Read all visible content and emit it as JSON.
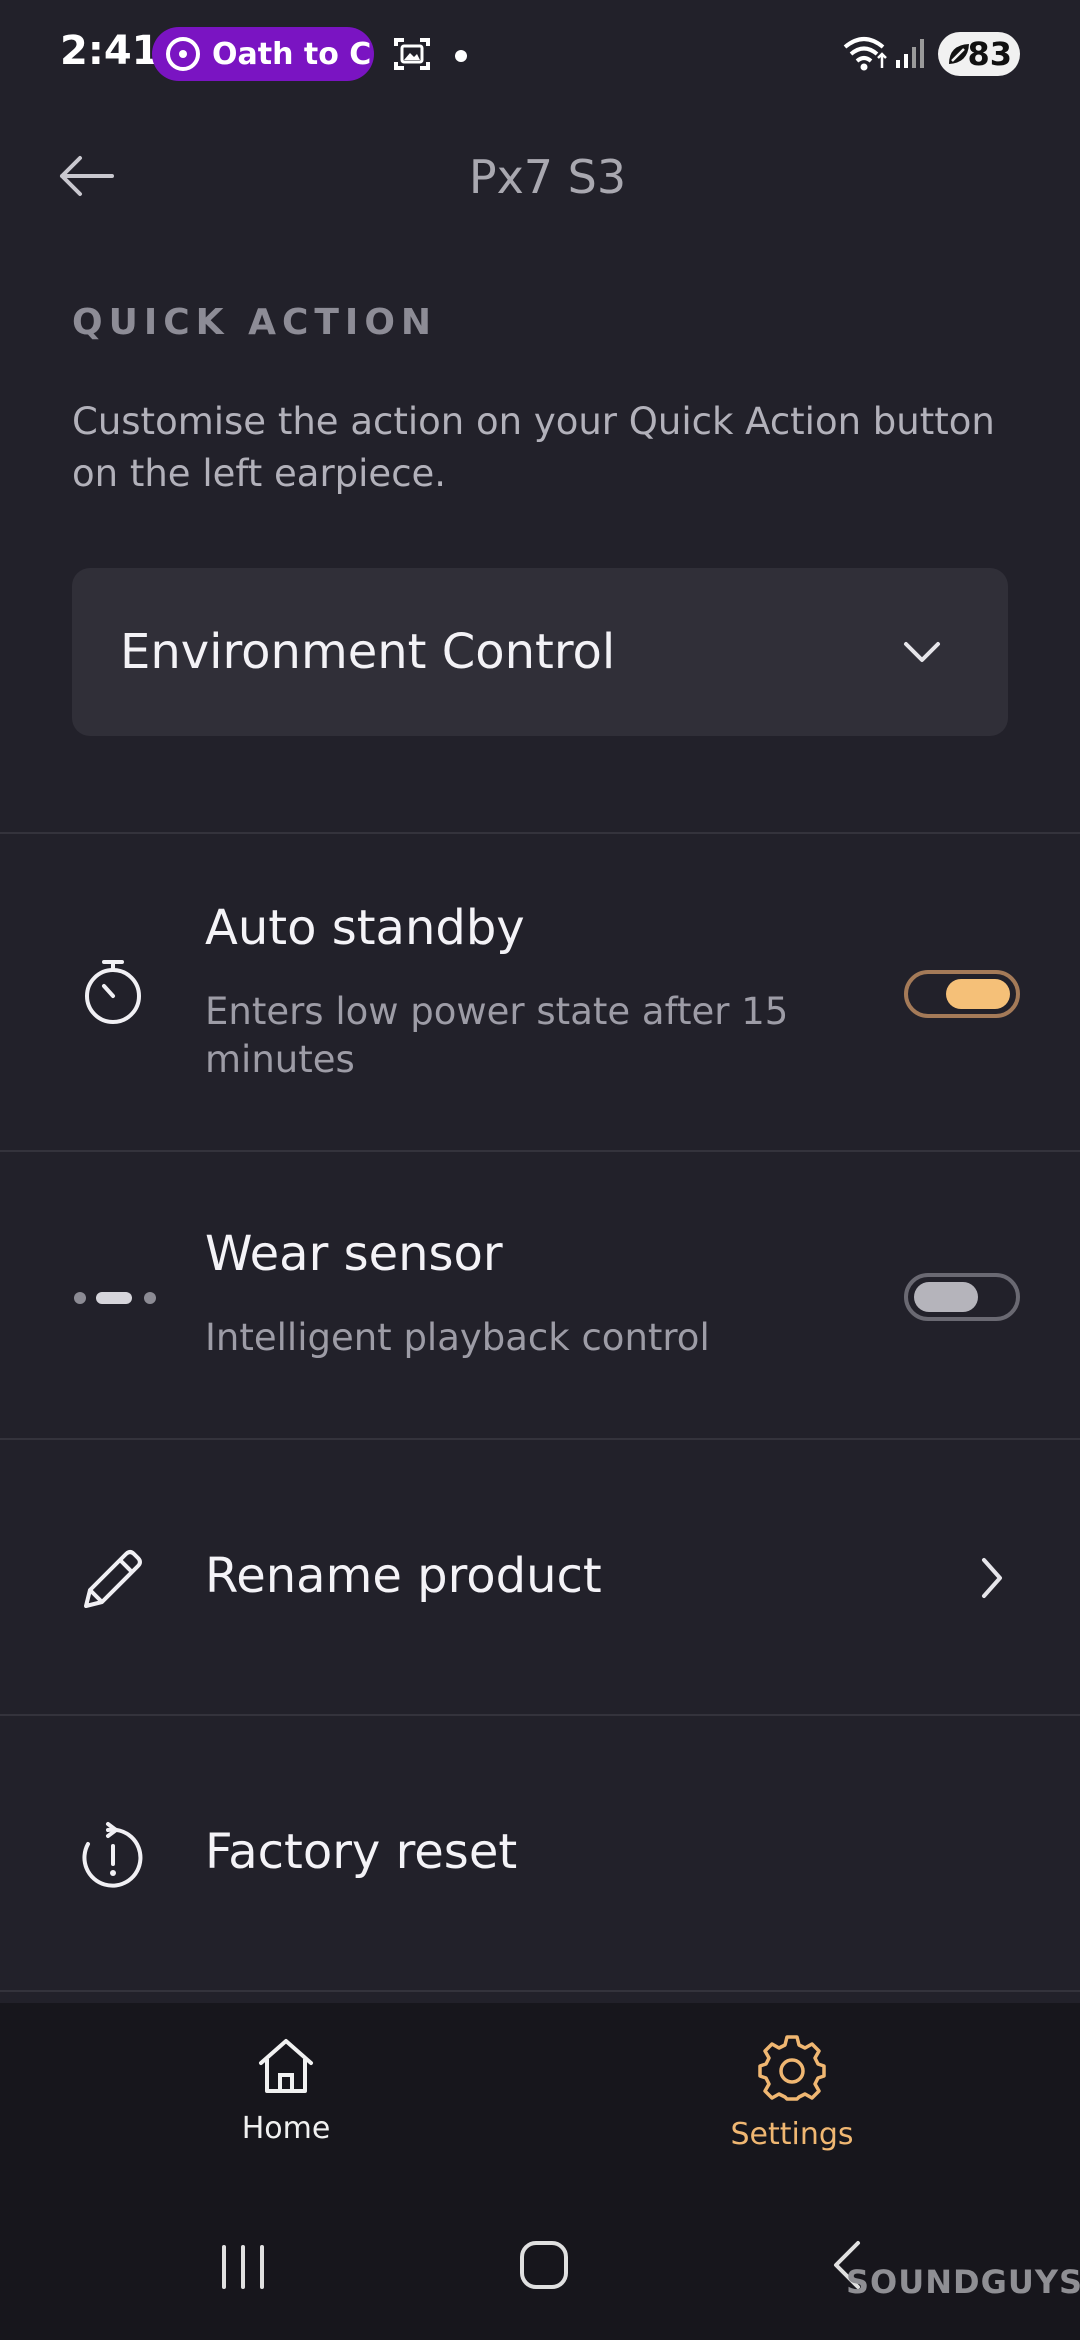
{
  "status_bar": {
    "time": "2:41",
    "media_pill_text": "Oath to C",
    "battery": "83"
  },
  "header": {
    "title": "Px7 S3"
  },
  "quick_action": {
    "section_label": "QUICK ACTION",
    "description": "Customise the action on your Quick Action button on the left earpiece.",
    "dropdown_value": "Environment Control"
  },
  "settings": {
    "auto_standby": {
      "title": "Auto standby",
      "subtitle": "Enters low power state after 15 minutes",
      "enabled": true
    },
    "wear_sensor": {
      "title": "Wear sensor",
      "subtitle": "Intelligent playback control",
      "enabled": false
    },
    "rename_product": {
      "title": "Rename product"
    },
    "factory_reset": {
      "title": "Factory reset"
    }
  },
  "bottom_nav": {
    "items": [
      {
        "label": "Home",
        "icon": "home-icon",
        "active": false
      },
      {
        "label": "Settings",
        "icon": "gear-icon",
        "active": true
      }
    ]
  },
  "watermark": "SOUNDGUYS",
  "colors": {
    "background": "#22212a",
    "accent": "#f0b772",
    "toggle_on": "#f5c078",
    "media_pill": "#7a14c2"
  }
}
